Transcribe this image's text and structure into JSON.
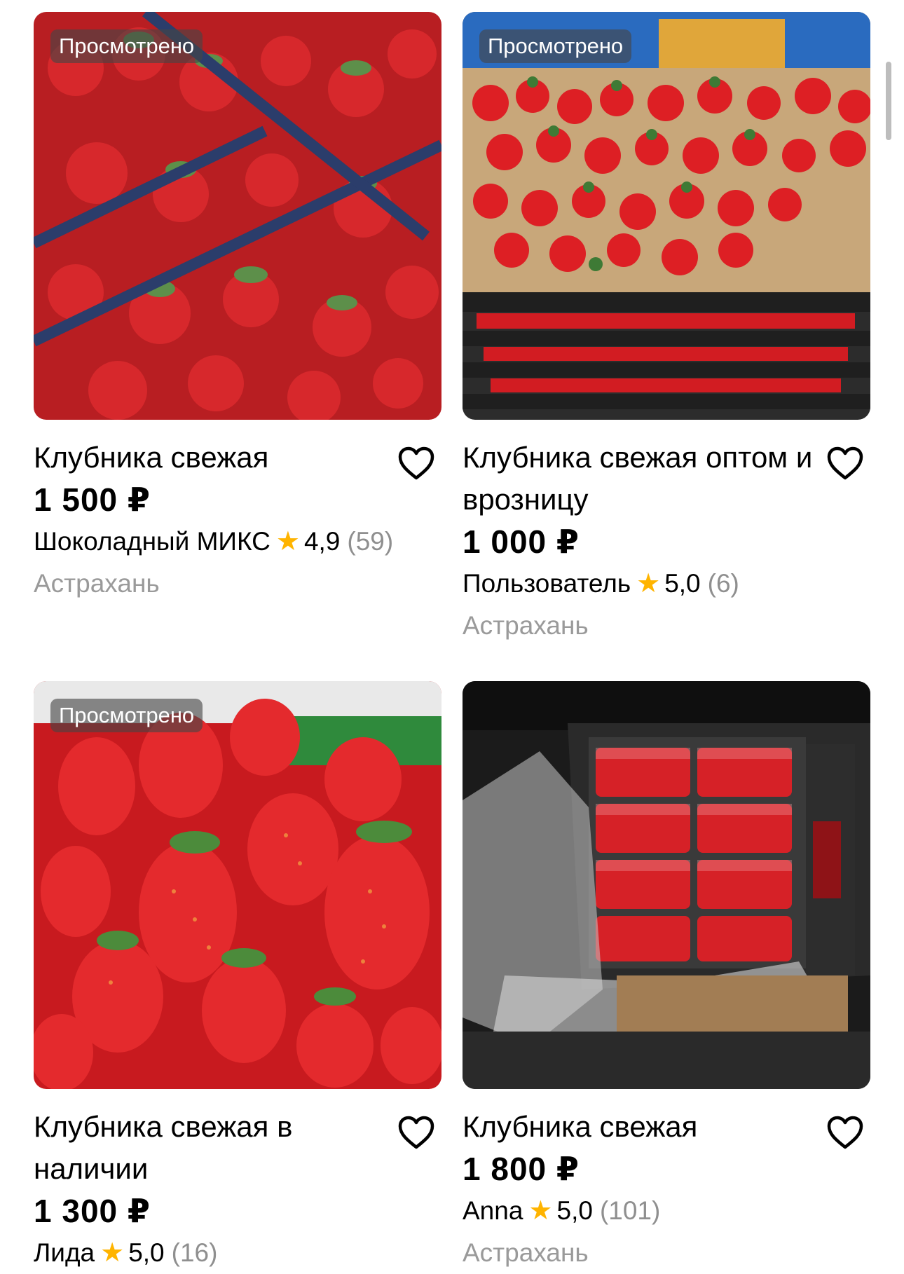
{
  "listings": [
    {
      "seen_badge": "Просмотрено",
      "title": "Клубника свежая",
      "price": "1 500 ₽",
      "seller": "Шоколадный МИКС",
      "rating": "4,9",
      "reviews": "(59)",
      "city": "Астрахань"
    },
    {
      "seen_badge": "Просмотрено",
      "title": "Клубника свежая оптом и врозницу",
      "price": "1 000 ₽",
      "seller": "Пользователь",
      "rating": "5,0",
      "reviews": "(6)",
      "city": "Астрахань"
    },
    {
      "seen_badge": "Просмотрено",
      "title": "Клубника свежая в наличии",
      "price": "1 300 ₽",
      "seller": "Лида",
      "rating": "5,0",
      "reviews": "(16)",
      "city": ""
    },
    {
      "seen_badge": "",
      "title": "Клубника свежая",
      "price": "1 800 ₽",
      "seller": "Anna",
      "rating": "5,0",
      "reviews": "(101)",
      "city": "Астрахань"
    }
  ],
  "icons": {
    "favorite": "heart-outline-icon",
    "rating": "star-icon"
  },
  "colors": {
    "rating_star": "#ffb400",
    "secondary_text": "#9a9a9a",
    "badge_bg": "#464646"
  }
}
